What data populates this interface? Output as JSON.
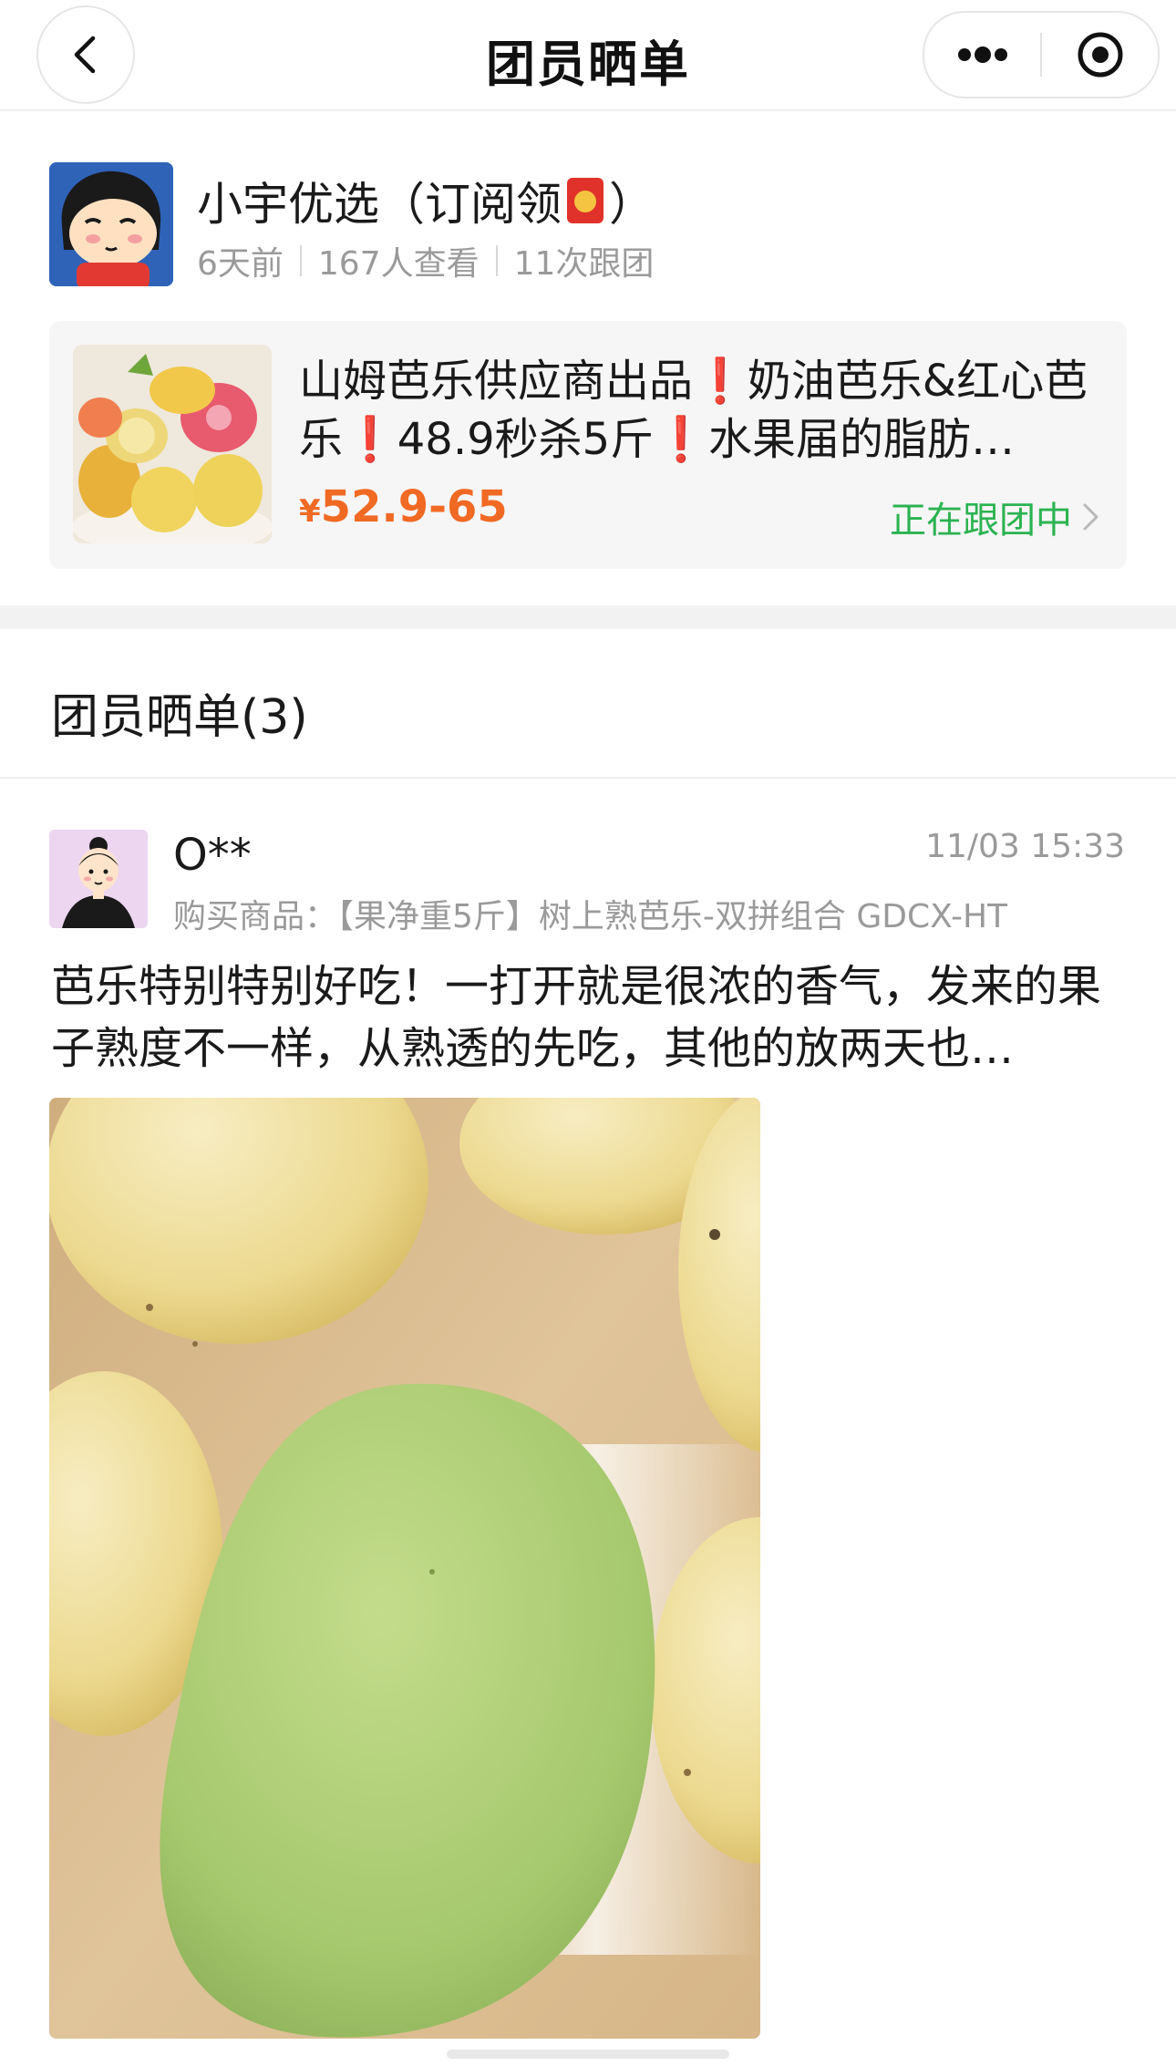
{
  "navbar": {
    "title": "团员晒单",
    "back_icon": "chevron-left-icon",
    "more_icon": "more-dots-icon",
    "close_icon": "target-circle-icon"
  },
  "leader": {
    "name_prefix": "小宇优选（订阅领",
    "name_emoji": "red-envelope-icon",
    "name_suffix": "）",
    "time_ago": "6天前",
    "views": "167人查看",
    "joins": "11次跟团"
  },
  "product": {
    "title": "山姆芭乐供应商出品❗奶油芭乐&红心芭乐❗48.9秒杀5斤❗水果届的脂肪…",
    "price_symbol": "¥",
    "price": "52.9-65",
    "status": "正在跟团中",
    "status_icon": "chevron-right-icon"
  },
  "reviews": {
    "header": "团员晒单(3)",
    "items": [
      {
        "name": "O**",
        "time": "11/03 15:33",
        "purchase_label": "购买商品：",
        "purchase_item": "【果净重5斤】树上熟芭乐-双拼组合 GDCX-HT",
        "text": "芭乐特别特别好吃！一打开就是很浓的香气，发来的果子熟度不一样，从熟透的先吃，其他的放两天也…"
      }
    ]
  },
  "colors": {
    "price": "#f06a24",
    "status": "#2bb351",
    "muted": "#9a9a9a"
  }
}
